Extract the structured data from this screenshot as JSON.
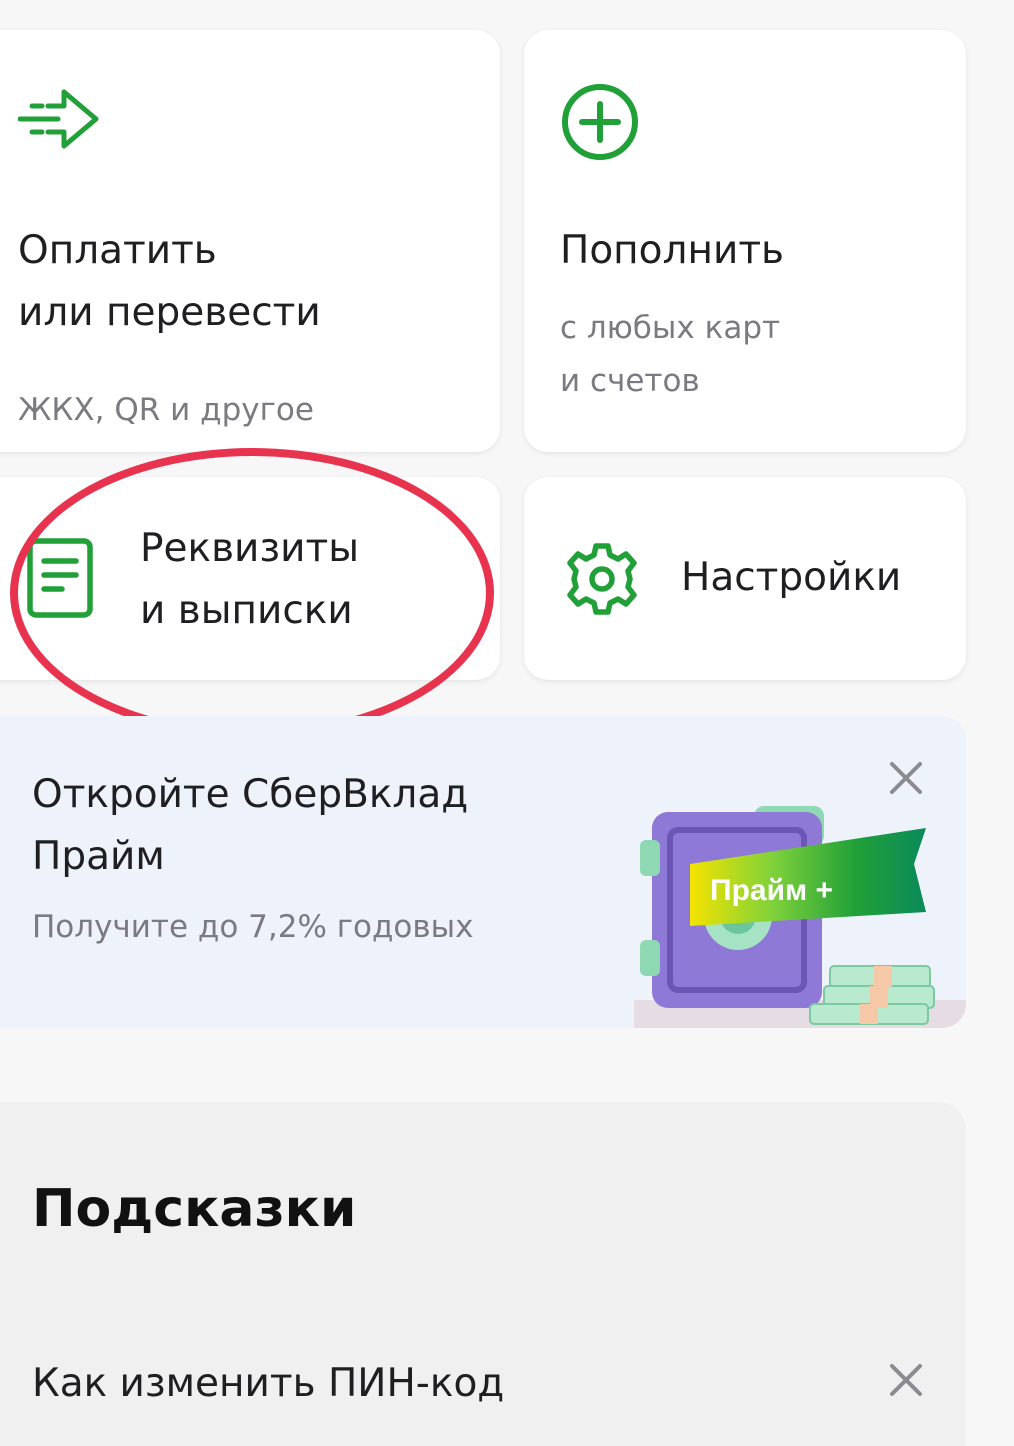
{
  "colors": {
    "accent_green": "#21a038",
    "highlight_red": "#e8334f",
    "promo_background": "#eef2fb",
    "tips_background": "#f0f0f0"
  },
  "actions": {
    "pay": {
      "icon": "send-arrow-icon",
      "title_line1": "Оплатить",
      "title_line2": "или перевести",
      "subtitle": "ЖКХ, QR и другое"
    },
    "topup": {
      "icon": "plus-circle-icon",
      "title": "Пополнить",
      "subtitle_line1": "с любых карт",
      "subtitle_line2": "и счетов"
    },
    "requisites": {
      "icon": "document-icon",
      "title_line1": "Реквизиты",
      "title_line2": "и выписки"
    },
    "settings": {
      "icon": "gear-icon",
      "title": "Настройки"
    }
  },
  "promo": {
    "title_line1": "Откройте СберВклад",
    "title_line2": "Прайм",
    "subtitle": "Получите до 7,2% годовых",
    "badge": "Прайм +",
    "close_icon": "close-icon"
  },
  "tips": {
    "title": "Подсказки",
    "items": [
      {
        "text": "Как изменить ПИН-код",
        "close_icon": "close-icon"
      }
    ]
  }
}
